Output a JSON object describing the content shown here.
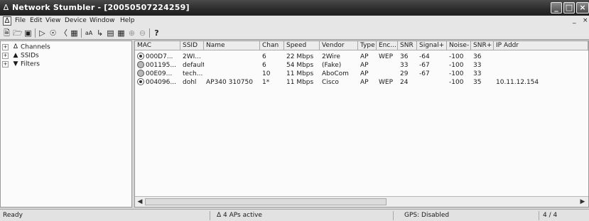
{
  "window": {
    "title": "Network Stumbler - [20050507224259]",
    "title_icon": "network-stumbler-app-icon"
  },
  "menu": [
    "File",
    "Edit",
    "View",
    "Device",
    "Window",
    "Help"
  ],
  "mdi_controls": [
    "_",
    "×"
  ],
  "toolbar_icons": [
    "new-file-icon",
    "open-folder-icon",
    "save-icon",
    "play-icon",
    "auto-config-icon",
    "scan-speed-icon",
    "properties-icon",
    "font-icon",
    "tree-view-icon",
    "columns-icon",
    "zoom-in-icon",
    "zoom-out-icon",
    "help-icon"
  ],
  "tree": [
    {
      "label": "Channels",
      "icon": "channels-icon"
    },
    {
      "label": "SSIDs",
      "icon": "ssids-icon"
    },
    {
      "label": "Filters",
      "icon": "filters-icon"
    }
  ],
  "columns": [
    "MAC",
    "SSID",
    "Name",
    "Chan",
    "Speed",
    "Vendor",
    "Type",
    "Enc...",
    "SNR",
    "Signal+",
    "Noise-",
    "SNR+",
    "IP Addr"
  ],
  "rows": [
    {
      "signal": "on",
      "mac": "000D7...",
      "ssid": "2WI...",
      "name": "",
      "chan": "6",
      "speed": "22 Mbps",
      "vendor": "2Wire",
      "type": "AP",
      "enc": "WEP",
      "snr": "36",
      "signal_plus": "-64",
      "noise": "-100",
      "snr_plus": "36",
      "ip": ""
    },
    {
      "signal": "off",
      "mac": "001195...",
      "ssid": "default",
      "name": "",
      "chan": "6",
      "speed": "54 Mbps",
      "vendor": "(Fake)",
      "type": "AP",
      "enc": "",
      "snr": "33",
      "signal_plus": "-67",
      "noise": "-100",
      "snr_plus": "33",
      "ip": ""
    },
    {
      "signal": "off",
      "mac": "00E09...",
      "ssid": "tech...",
      "name": "",
      "chan": "10",
      "speed": "11 Mbps",
      "vendor": "AboCom",
      "type": "AP",
      "enc": "",
      "snr": "29",
      "signal_plus": "-67",
      "noise": "-100",
      "snr_plus": "33",
      "ip": ""
    },
    {
      "signal": "on",
      "mac": "004096...",
      "ssid": "dohl",
      "name": "AP340 310750",
      "chan": "1*",
      "speed": "11 Mbps",
      "vendor": "Cisco",
      "type": "AP",
      "enc": "WEP",
      "snr": "24",
      "signal_plus": "",
      "noise": "-100",
      "snr_plus": "35",
      "ip": "10.11.12.154"
    }
  ],
  "status": {
    "left": "Ready",
    "aps": "4 APs active",
    "aps_icon": "antenna-icon",
    "gps": "GPS: Disabled",
    "count": "4 / 4"
  }
}
